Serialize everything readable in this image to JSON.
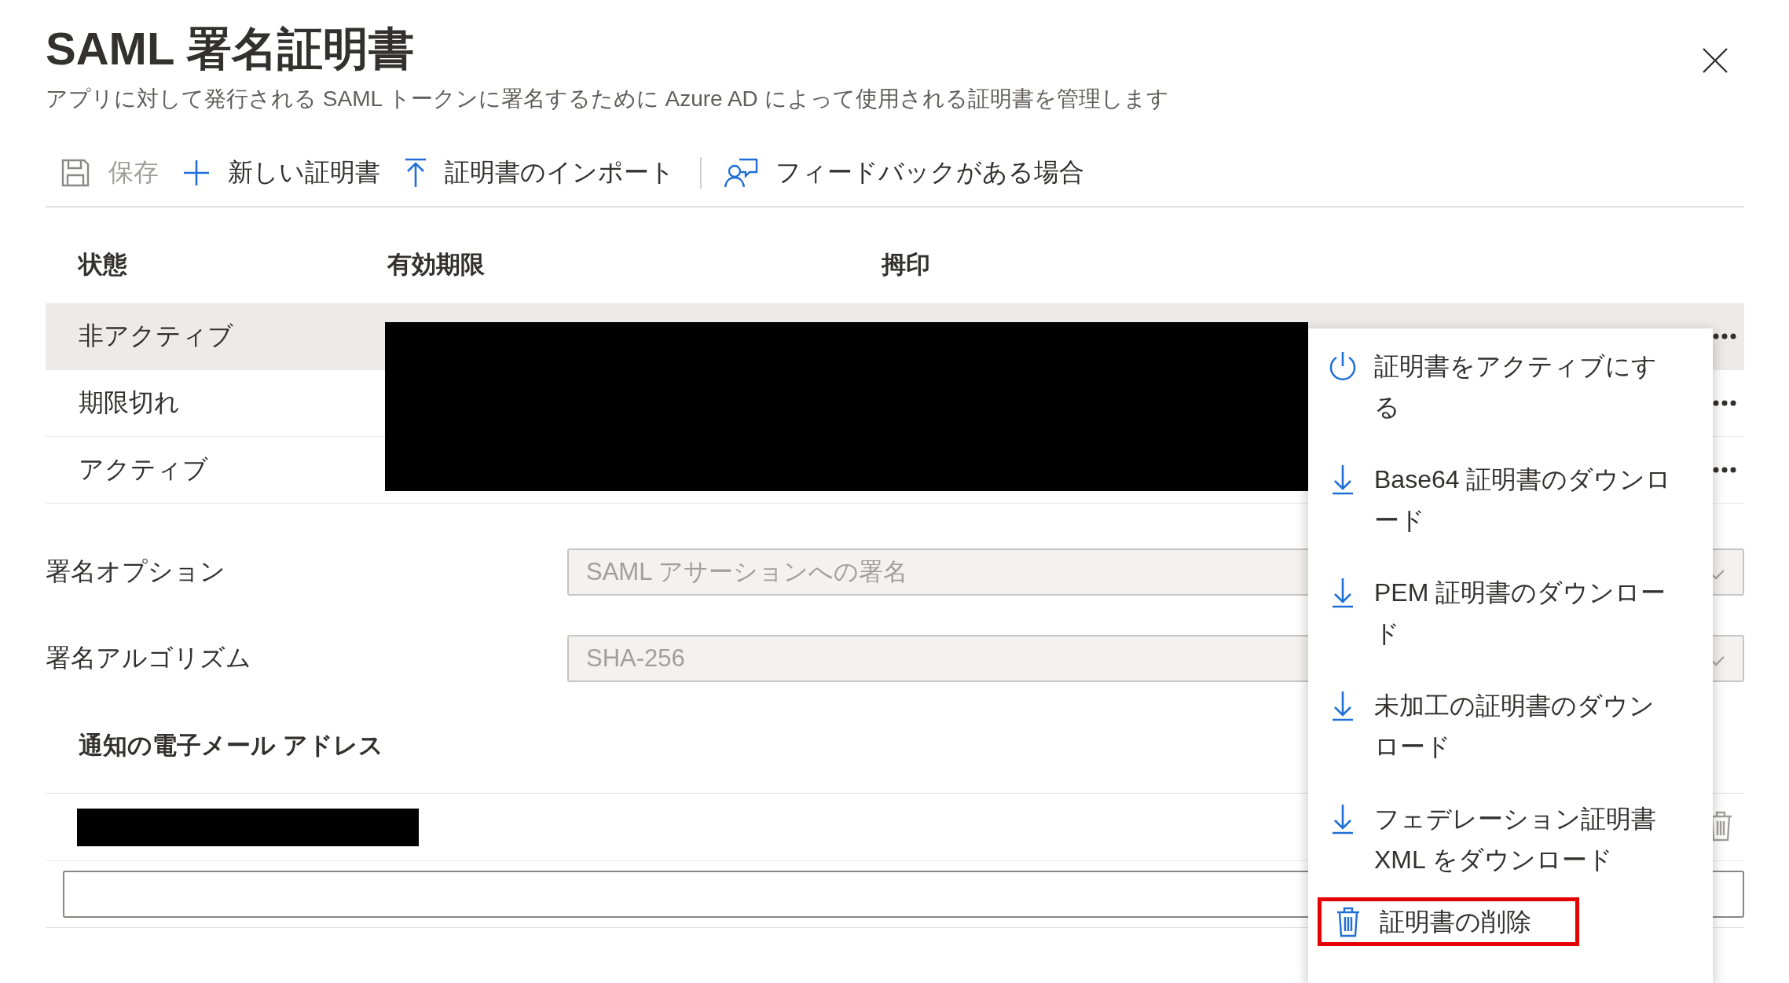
{
  "panel": {
    "title": "SAML 署名証明書",
    "subtitle": "アプリに対して発行される SAML トークンに署名するために Azure AD によって使用される証明書を管理します"
  },
  "toolbar": {
    "groups": [
      [
        {
          "kind": "save",
          "label": "保存",
          "disabled": true
        },
        {
          "kind": "add",
          "label": "新しい証明書",
          "disabled": false
        },
        {
          "kind": "import",
          "label": "証明書のインポート",
          "disabled": false
        }
      ],
      [
        {
          "kind": "feedback",
          "label": "フィードバックがある場合",
          "disabled": false
        }
      ]
    ]
  },
  "certificates": {
    "columns": [
      "状態",
      "有効期限",
      "拇印"
    ],
    "rows": [
      {
        "status": "非アクティブ",
        "selected": true
      },
      {
        "status": "期限切れ",
        "selected": false
      },
      {
        "status": "アクティブ",
        "selected": false
      }
    ]
  },
  "signing_options": [
    {
      "label": "署名オプション",
      "value": "SAML アサーションへの署名",
      "disabled": true
    },
    {
      "label": "署名アルゴリズム",
      "value": "SHA-256",
      "disabled": true
    }
  ],
  "notification_emails": {
    "heading": "通知の電子メール アドレス"
  },
  "context_menu": [
    {
      "kind": "power",
      "label": "証明書をアクティブにする",
      "highlighted": false
    },
    {
      "kind": "download",
      "label": "Base64 証明書のダウンロード",
      "highlighted": false
    },
    {
      "kind": "download",
      "label": "PEM 証明書のダウンロード",
      "highlighted": false
    },
    {
      "kind": "download",
      "label": "未加工の証明書のダウンロード",
      "highlighted": false
    },
    {
      "kind": "download",
      "label": "フェデレーション証明書 XML をダウンロード",
      "highlighted": false
    },
    {
      "kind": "trash",
      "label": "証明書の削除",
      "highlighted": true
    }
  ]
}
